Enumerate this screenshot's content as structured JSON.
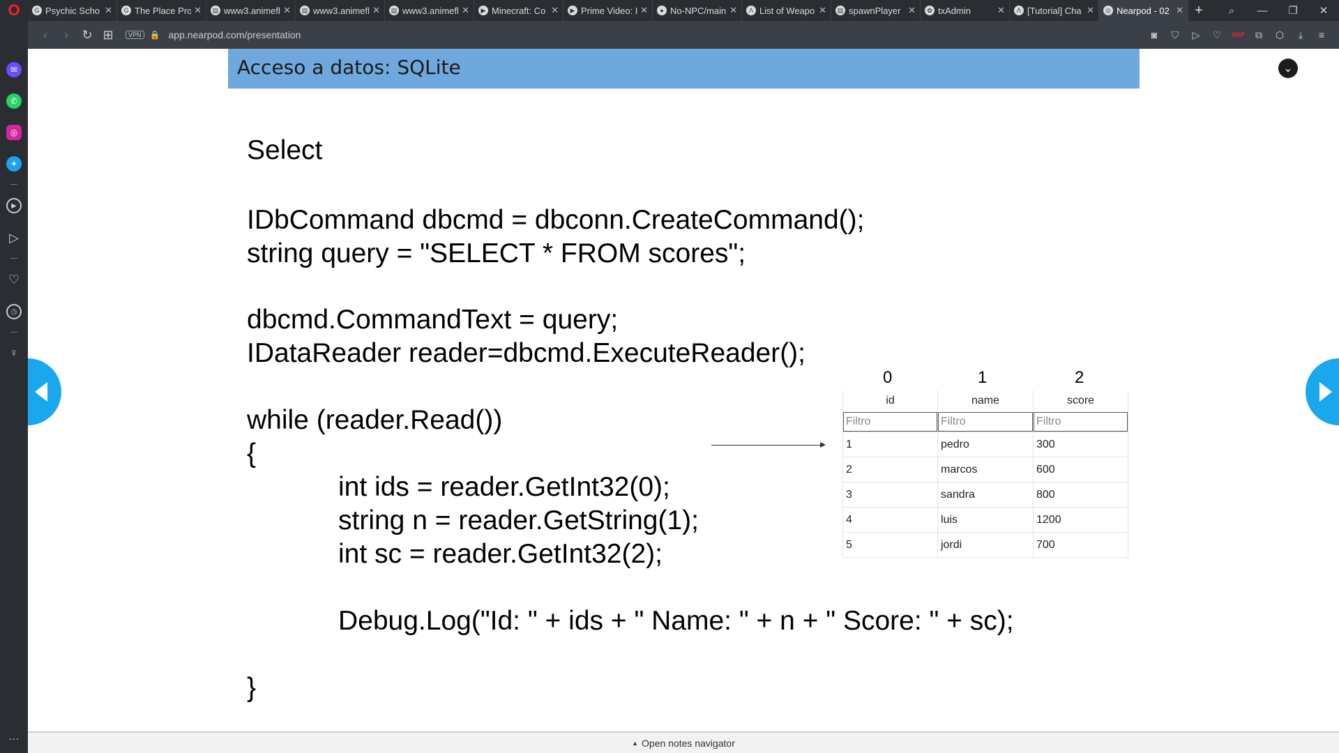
{
  "tabs": [
    {
      "title": "Psychic Scho",
      "favicon": "G"
    },
    {
      "title": "The Place Pro",
      "favicon": "G"
    },
    {
      "title": "www3.animefl",
      "favicon": "▤"
    },
    {
      "title": "www3.animefl",
      "favicon": "▤"
    },
    {
      "title": "www3.animefl",
      "favicon": "▤"
    },
    {
      "title": "Minecraft: Co",
      "favicon": "▶"
    },
    {
      "title": "Prime Video: I",
      "favicon": "▶"
    },
    {
      "title": "No-NPC/main",
      "favicon": "●"
    },
    {
      "title": "List of Weapo",
      "favicon": "Λ"
    },
    {
      "title": "spawnPlayer",
      "favicon": "▤"
    },
    {
      "title": "txAdmin",
      "favicon": "✿"
    },
    {
      "title": "[Tutorial] Cha",
      "favicon": "Λ"
    },
    {
      "title": "Nearpod - 02",
      "favicon": "◎",
      "active": true
    }
  ],
  "address_bar": {
    "vpn_label": "VPN",
    "url": "app.nearpod.com/presentation"
  },
  "slide": {
    "header_title": "Acceso a datos: SQLite",
    "heading": "Select",
    "code_lines": [
      "IDbCommand dbcmd = dbconn.CreateCommand();",
      "string query = \"SELECT * FROM scores\";",
      "dbcmd.CommandText = query;",
      "IDataReader reader=dbcmd.ExecuteReader();",
      "while (reader.Read())",
      "{",
      "int ids = reader.GetInt32(0);",
      "string n = reader.GetString(1);",
      "int sc = reader.GetInt32(2);",
      "Debug.Log(\"Id: \" + ids + \" Name: \" + n + \" Score: \" + sc);",
      "}"
    ],
    "table": {
      "column_indices": [
        "0",
        "1",
        "2"
      ],
      "columns": [
        "id",
        "name",
        "score"
      ],
      "filter_placeholder": "Filtro",
      "rows": [
        [
          "1",
          "pedro",
          "300"
        ],
        [
          "2",
          "marcos",
          "600"
        ],
        [
          "3",
          "sandra",
          "800"
        ],
        [
          "4",
          "luis",
          "1200"
        ],
        [
          "5",
          "jordi",
          "700"
        ]
      ]
    }
  },
  "notes_navigator": "Open notes navigator",
  "colors": {
    "header_bg": "#6fa8dc",
    "nav_arrow": "#1aa7ee",
    "browser_chrome": "#2a2e33"
  }
}
